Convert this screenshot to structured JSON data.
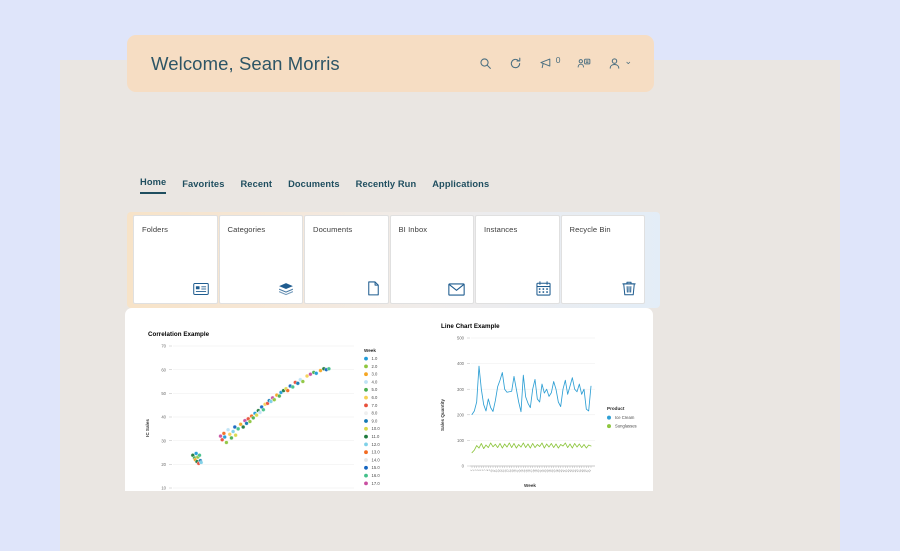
{
  "page": {
    "outer_bg": "#dfe5fa",
    "content_bg": "#eae6e2",
    "banner_bg": "#f6ddc3",
    "accent": "#1f4e5f"
  },
  "header": {
    "title": "Welcome, Sean Morris",
    "actions": [
      {
        "name": "search-icon",
        "label": "Search"
      },
      {
        "name": "refresh-icon",
        "label": "Refresh"
      },
      {
        "name": "announcement-icon",
        "label": "Announcements",
        "badge": "0"
      },
      {
        "name": "teams-icon",
        "label": "Teams"
      },
      {
        "name": "user-icon",
        "label": "User Menu",
        "chevron": "⌄"
      }
    ]
  },
  "main_nav": {
    "tabs": [
      {
        "label": "Home",
        "active": true
      },
      {
        "label": "Favorites",
        "active": false
      },
      {
        "label": "Recent",
        "active": false
      },
      {
        "label": "Documents",
        "active": false
      },
      {
        "label": "Recently Run",
        "active": false
      },
      {
        "label": "Applications",
        "active": false
      }
    ]
  },
  "tiles": [
    {
      "label": "Folders",
      "icon": "folders-icon"
    },
    {
      "label": "Categories",
      "icon": "categories-icon"
    },
    {
      "label": "Documents",
      "icon": "document-icon"
    },
    {
      "label": "BI Inbox",
      "icon": "envelope-icon"
    },
    {
      "label": "Instances",
      "icon": "calendar-icon"
    },
    {
      "label": "Recycle Bin",
      "icon": "trash-icon"
    }
  ],
  "section": {
    "tab_label": "Correlation Example"
  },
  "chart_data": [
    {
      "type": "scatter",
      "title": "Correlation Example",
      "xlabel": "",
      "ylabel": "IC Sales",
      "ylim": [
        10,
        70
      ],
      "yticks": [
        "70",
        "60",
        "50",
        "40",
        "30",
        "20",
        "10"
      ],
      "grid": true,
      "legend": {
        "title": "Week",
        "position": "right",
        "entries": [
          {
            "label": "1.0",
            "color": "#1f9bd8"
          },
          {
            "label": "2.0",
            "color": "#8ec63f"
          },
          {
            "label": "3.0",
            "color": "#f5a623"
          },
          {
            "label": "4.0",
            "color": "#bfe3f5"
          },
          {
            "label": "5.0",
            "color": "#4caf50"
          },
          {
            "label": "6.0",
            "color": "#f7d154"
          },
          {
            "label": "7.0",
            "color": "#e8503a"
          },
          {
            "label": "8.0",
            "color": "#efefef"
          },
          {
            "label": "9.0",
            "color": "#1379b4"
          },
          {
            "label": "10.0",
            "color": "#d9d94a"
          },
          {
            "label": "11.0",
            "color": "#1f7a3d"
          },
          {
            "label": "12.0",
            "color": "#7fd1e8"
          },
          {
            "label": "13.0",
            "color": "#f26b21"
          },
          {
            "label": "14.0",
            "color": "#e5e5e5"
          },
          {
            "label": "15.0",
            "color": "#1565c0"
          },
          {
            "label": "16.0",
            "color": "#43c08a"
          },
          {
            "label": "17.0",
            "color": "#c94fa1"
          }
        ]
      },
      "points": [
        {
          "x": 0.1,
          "y": 0.3,
          "c": "#1f7a3d"
        },
        {
          "x": 0.11,
          "y": 0.285,
          "c": "#4caf50"
        },
        {
          "x": 0.115,
          "y": 0.275,
          "c": "#f5a623"
        },
        {
          "x": 0.12,
          "y": 0.31,
          "c": "#1f9bd8"
        },
        {
          "x": 0.125,
          "y": 0.265,
          "c": "#1f7a3d"
        },
        {
          "x": 0.13,
          "y": 0.29,
          "c": "#8ec63f"
        },
        {
          "x": 0.135,
          "y": 0.255,
          "c": "#e8503a"
        },
        {
          "x": 0.14,
          "y": 0.3,
          "c": "#43c08a"
        },
        {
          "x": 0.145,
          "y": 0.27,
          "c": "#1379b4"
        },
        {
          "x": 0.15,
          "y": 0.26,
          "c": "#7fd1e8"
        },
        {
          "x": 0.265,
          "y": 0.405,
          "c": "#c94fa1"
        },
        {
          "x": 0.275,
          "y": 0.385,
          "c": "#e8503a"
        },
        {
          "x": 0.285,
          "y": 0.42,
          "c": "#f26b21"
        },
        {
          "x": 0.29,
          "y": 0.4,
          "c": "#1f9bd8"
        },
        {
          "x": 0.3,
          "y": 0.37,
          "c": "#8ec63f"
        },
        {
          "x": 0.31,
          "y": 0.44,
          "c": "#bfe3f5"
        },
        {
          "x": 0.32,
          "y": 0.415,
          "c": "#f7d154"
        },
        {
          "x": 0.33,
          "y": 0.395,
          "c": "#4caf50"
        },
        {
          "x": 0.34,
          "y": 0.43,
          "c": "#7fd1e8"
        },
        {
          "x": 0.35,
          "y": 0.455,
          "c": "#1565c0"
        },
        {
          "x": 0.355,
          "y": 0.41,
          "c": "#d9d94a"
        },
        {
          "x": 0.37,
          "y": 0.445,
          "c": "#43c08a"
        },
        {
          "x": 0.385,
          "y": 0.47,
          "c": "#f5a623"
        },
        {
          "x": 0.4,
          "y": 0.455,
          "c": "#1f7a3d"
        },
        {
          "x": 0.41,
          "y": 0.49,
          "c": "#c94fa1"
        },
        {
          "x": 0.42,
          "y": 0.475,
          "c": "#1379b4"
        },
        {
          "x": 0.43,
          "y": 0.5,
          "c": "#e8503a"
        },
        {
          "x": 0.44,
          "y": 0.485,
          "c": "#8ec63f"
        },
        {
          "x": 0.45,
          "y": 0.515,
          "c": "#f26b21"
        },
        {
          "x": 0.46,
          "y": 0.505,
          "c": "#4caf50"
        },
        {
          "x": 0.47,
          "y": 0.53,
          "c": "#1f9bd8"
        },
        {
          "x": 0.48,
          "y": 0.52,
          "c": "#d9d94a"
        },
        {
          "x": 0.49,
          "y": 0.545,
          "c": "#1f7a3d"
        },
        {
          "x": 0.5,
          "y": 0.535,
          "c": "#bfe3f5"
        },
        {
          "x": 0.51,
          "y": 0.565,
          "c": "#1565c0"
        },
        {
          "x": 0.52,
          "y": 0.55,
          "c": "#43c08a"
        },
        {
          "x": 0.53,
          "y": 0.58,
          "c": "#f7d154"
        },
        {
          "x": 0.545,
          "y": 0.585,
          "c": "#e8503a"
        },
        {
          "x": 0.555,
          "y": 0.6,
          "c": "#1379b4"
        },
        {
          "x": 0.565,
          "y": 0.595,
          "c": "#7fd1e8"
        },
        {
          "x": 0.575,
          "y": 0.615,
          "c": "#c94fa1"
        },
        {
          "x": 0.585,
          "y": 0.605,
          "c": "#8ec63f"
        },
        {
          "x": 0.6,
          "y": 0.63,
          "c": "#f5a623"
        },
        {
          "x": 0.615,
          "y": 0.625,
          "c": "#4caf50"
        },
        {
          "x": 0.625,
          "y": 0.645,
          "c": "#1f9bd8"
        },
        {
          "x": 0.64,
          "y": 0.655,
          "c": "#1f7a3d"
        },
        {
          "x": 0.655,
          "y": 0.665,
          "c": "#d9d94a"
        },
        {
          "x": 0.665,
          "y": 0.655,
          "c": "#f26b21"
        },
        {
          "x": 0.68,
          "y": 0.68,
          "c": "#1565c0"
        },
        {
          "x": 0.695,
          "y": 0.675,
          "c": "#43c08a"
        },
        {
          "x": 0.71,
          "y": 0.7,
          "c": "#e8503a"
        },
        {
          "x": 0.725,
          "y": 0.695,
          "c": "#1379b4"
        },
        {
          "x": 0.74,
          "y": 0.715,
          "c": "#bfe3f5"
        },
        {
          "x": 0.755,
          "y": 0.705,
          "c": "#8ec63f"
        },
        {
          "x": 0.78,
          "y": 0.735,
          "c": "#f7d154"
        },
        {
          "x": 0.8,
          "y": 0.745,
          "c": "#c94fa1"
        },
        {
          "x": 0.82,
          "y": 0.755,
          "c": "#4caf50"
        },
        {
          "x": 0.835,
          "y": 0.75,
          "c": "#1f9bd8"
        },
        {
          "x": 0.86,
          "y": 0.765,
          "c": "#f5a623"
        },
        {
          "x": 0.88,
          "y": 0.775,
          "c": "#1f7a3d"
        },
        {
          "x": 0.895,
          "y": 0.77,
          "c": "#1565c0"
        },
        {
          "x": 0.91,
          "y": 0.775,
          "c": "#43c08a"
        }
      ]
    },
    {
      "type": "line",
      "title": "Line Chart Example",
      "xlabel": "Week",
      "ylabel": "Sales Quantity",
      "yticks": [
        "500",
        "400",
        "300",
        "200",
        "100",
        "0"
      ],
      "ylim": [
        0,
        500
      ],
      "grid": true,
      "legend": {
        "title": "Product",
        "position": "right",
        "entries": [
          {
            "label": "Ice Cream",
            "color": "#2e9fd4"
          },
          {
            "label": "Sunglasses",
            "color": "#8ec63f"
          }
        ]
      },
      "series": [
        {
          "name": "Ice Cream",
          "color": "#2e9fd4",
          "values": [
            201,
            215,
            250,
            390,
            300,
            240,
            215,
            262,
            228,
            213,
            255,
            310,
            335,
            365,
            300,
            288,
            290,
            292,
            350,
            300,
            250,
            212,
            355,
            270,
            245,
            228,
            300,
            338,
            262,
            250,
            320,
            285,
            300,
            272,
            286,
            330,
            300,
            250,
            232,
            300,
            335,
            280,
            312,
            345,
            300,
            290,
            320,
            280,
            300,
            222,
            215,
            312
          ]
        },
        {
          "name": "Sunglasses",
          "color": "#8ec63f",
          "values": [
            52,
            62,
            80,
            70,
            88,
            68,
            82,
            72,
            90,
            75,
            85,
            72,
            88,
            70,
            86,
            74,
            90,
            72,
            88,
            70,
            84,
            74,
            90,
            72,
            86,
            70,
            88,
            72,
            84,
            76,
            90,
            70,
            86,
            74,
            88,
            72,
            86,
            70,
            84,
            78,
            90,
            72,
            86,
            70,
            88,
            74,
            86,
            72,
            84,
            70,
            82,
            78
          ]
        }
      ]
    }
  ]
}
